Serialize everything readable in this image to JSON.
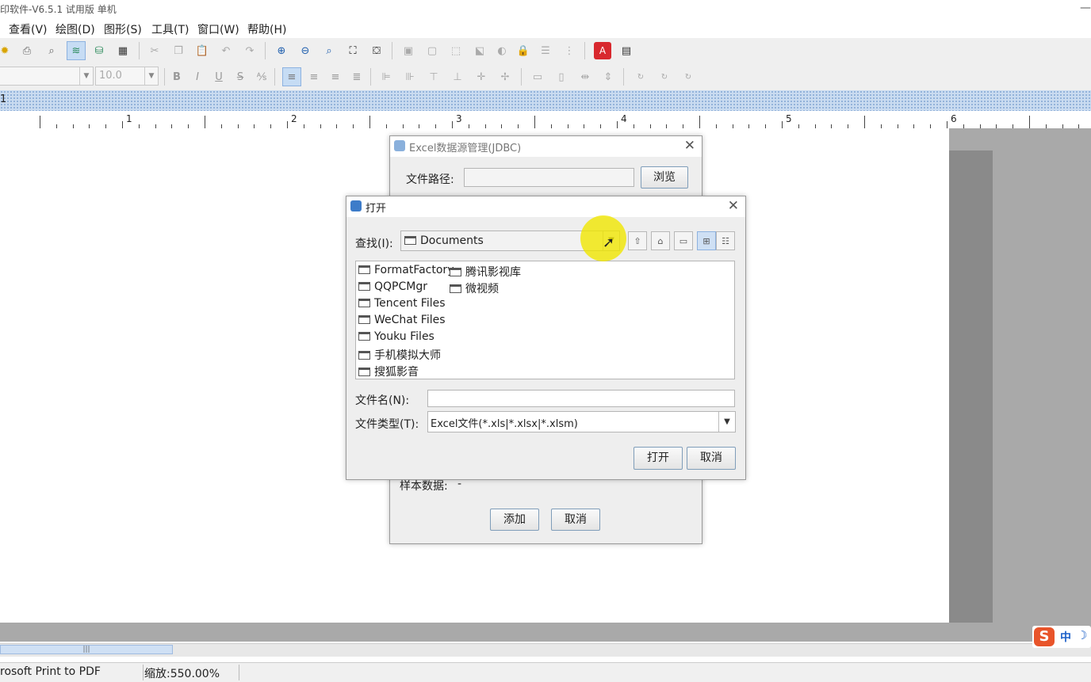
{
  "window": {
    "title": "印软件-V6.5.1 试用版 单机",
    "minimize": "—"
  },
  "menu": [
    "查看(V)",
    "绘图(D)",
    "图形(S)",
    "工具(T)",
    "窗口(W)",
    "帮助(H)"
  ],
  "toolbar2": {
    "font_size": "10.0",
    "bold": "B",
    "italic": "I",
    "underline": "U",
    "strike": "S"
  },
  "tabstrip": {
    "label": "1"
  },
  "ruler": [
    "1",
    "2",
    "3",
    "4",
    "5",
    "6"
  ],
  "status": {
    "printer": "rosoft Print to PDF",
    "zoom": "缩放:550.00%"
  },
  "ime": {
    "logo": "S",
    "mode": "中",
    "moon": "☽"
  },
  "excel_dialog": {
    "title": "Excel数据源管理(JDBC)",
    "file_path_label": "文件路径:",
    "browse": "浏览",
    "sample_label": "样本数据:",
    "sample_value": "-",
    "add": "添加",
    "cancel": "取消"
  },
  "open_dialog": {
    "title": "打开",
    "look_in_label": "查找(I):",
    "look_in_value": "Documents",
    "folders_col1": [
      "FormatFactory",
      "QQPCMgr",
      "Tencent Files",
      "WeChat Files",
      "Youku Files",
      "手机模拟大师",
      "搜狐影音"
    ],
    "folders_col2": [
      "腾讯影视库",
      "微视频"
    ],
    "file_name_label": "文件名(N):",
    "file_name_value": "",
    "file_type_label": "文件类型(T):",
    "file_type_value": "Excel文件(*.xls|*.xlsx|*.xlsm)",
    "open": "打开",
    "cancel": "取消"
  }
}
